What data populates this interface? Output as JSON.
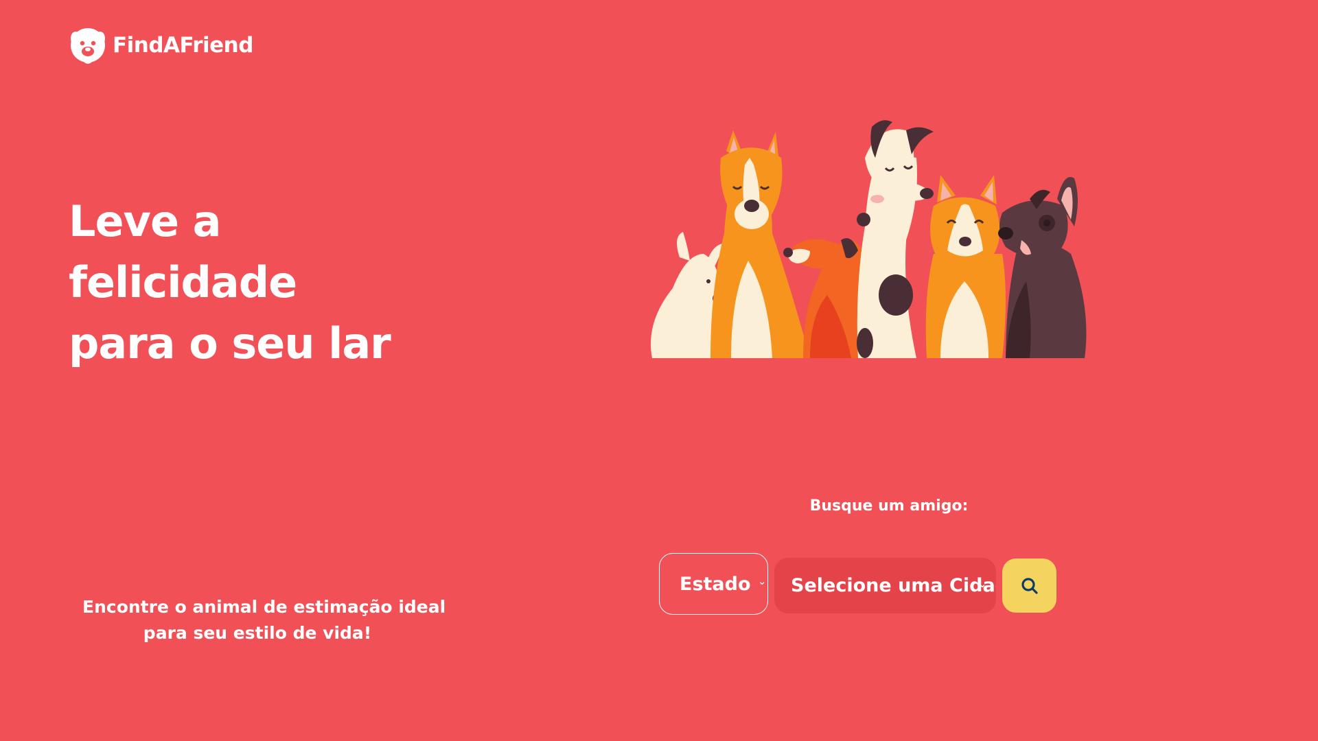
{
  "brand": {
    "name": "FindAFriend",
    "logo_icon": "dog-face-icon"
  },
  "hero": {
    "title_lines": [
      "Leve a",
      "felicidade",
      "para o seu lar"
    ],
    "tagline_lines": [
      "Encontre o animal de estimação ideal",
      "para seu estilo de vida!"
    ],
    "illustration_icon": "dogs-group-illustration"
  },
  "search": {
    "label": "Busque um amigo:",
    "state_select": {
      "selected": "Estado",
      "icon": "chevron-down-icon"
    },
    "city_select": {
      "selected": "Selecione uma Cidade",
      "icon": "chevron-down-icon"
    },
    "button": {
      "icon": "search-icon"
    }
  },
  "colors": {
    "background": "#F15156",
    "city_select_bg": "#E44449",
    "search_button_bg": "#F4D35E",
    "text": "#FFFFFF",
    "icon_dark": "#0D3B66"
  }
}
